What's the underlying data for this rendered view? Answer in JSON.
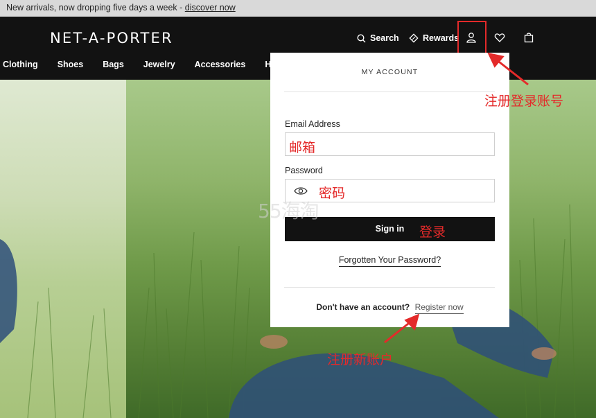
{
  "announcement": {
    "text": "New arrivals, now dropping five days a week - ",
    "link": "discover now"
  },
  "header": {
    "logo": "NET-A-PORTER",
    "search_label": "Search",
    "rewards_label": "Rewards",
    "nav": [
      "Clothing",
      "Shoes",
      "Bags",
      "Jewelry",
      "Accessories",
      "Hom"
    ]
  },
  "account_panel": {
    "title": "MY ACCOUNT",
    "email_label": "Email Address",
    "email_value": "",
    "password_label": "Password",
    "password_value": "",
    "signin_label": "Sign in",
    "forgot_label": "Forgotten Your Password?",
    "no_account_text": "Don't have an account?",
    "register_label": "Register now"
  },
  "annotations": {
    "account": "注册登录账号",
    "email": "邮箱",
    "password": "密码",
    "signin": "登录",
    "register": "注册新账户",
    "watermark": "55海淘"
  },
  "colors": {
    "header_bg": "#121212",
    "annotation_red": "#e42a2a",
    "announcement_bg": "#d9d9d9"
  },
  "icons": [
    "search-icon",
    "rewards-icon",
    "account-icon",
    "wishlist-icon",
    "bag-icon",
    "eye-icon"
  ]
}
